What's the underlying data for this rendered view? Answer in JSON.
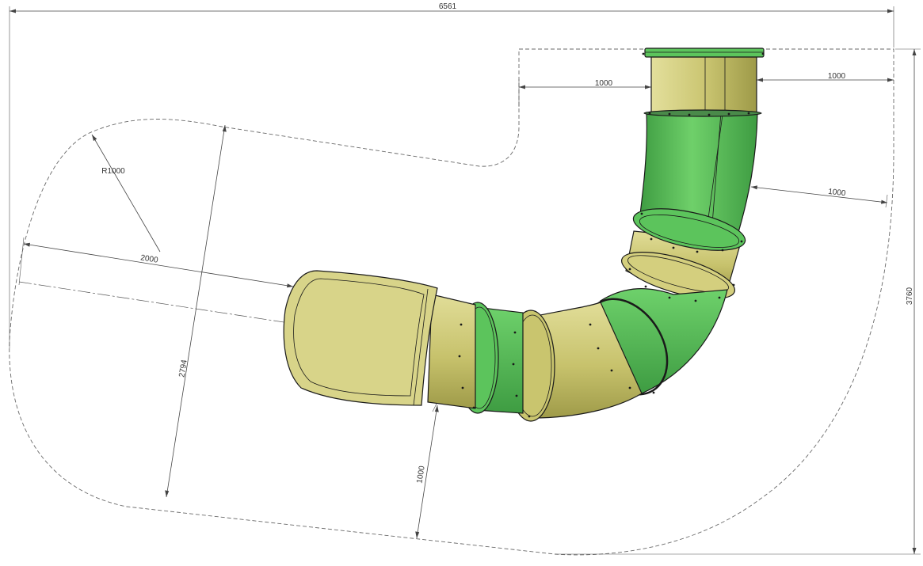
{
  "drawing": {
    "dimensions": {
      "overall_width": "6561",
      "overall_height": "3760",
      "top_offset_left": "1000",
      "top_offset_right": "1000",
      "side_offset": "1000",
      "radius": "R1000",
      "entry_length": "2000",
      "entry_height": "2794",
      "bottom_offset": "1000"
    },
    "colors": {
      "green": "#5cc45c",
      "green_dark": "#3a9a3e",
      "tan": "#c9c56e",
      "tan_dark": "#a8a44f",
      "tan_light": "#dedb93",
      "flange": "#4a8a4a"
    }
  }
}
